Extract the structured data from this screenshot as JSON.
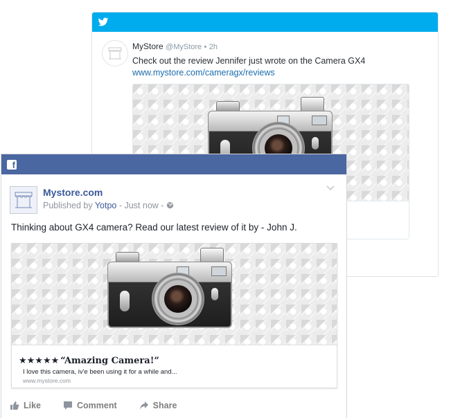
{
  "twitter": {
    "name": "MyStore",
    "handle": "@MyStore",
    "dot": "•",
    "time": "2h",
    "text": "Check out the review Jennifer just wrote on the Camera GX4",
    "link": "www.mystore.com/cameragx/reviews",
    "icon": "twitter-bird-icon",
    "brand_color": "#00aced"
  },
  "facebook": {
    "page_name": "Mystore.com",
    "published_prefix": "Published by",
    "published_by": "Yotpo",
    "published_suffix": "- Just now -",
    "post_text": "Thinking about GX4 camera? Read our latest review of it by - John J.",
    "link_card": {
      "stars": "★★★★★",
      "title": "“Amazing Camera!”",
      "description": "I love this camera, iv'e been using it for a while and...",
      "domain": "www.mystore.com"
    },
    "actions": {
      "like": "Like",
      "comment": "Comment",
      "share": "Share"
    },
    "brand_color": "#4b67a1"
  }
}
